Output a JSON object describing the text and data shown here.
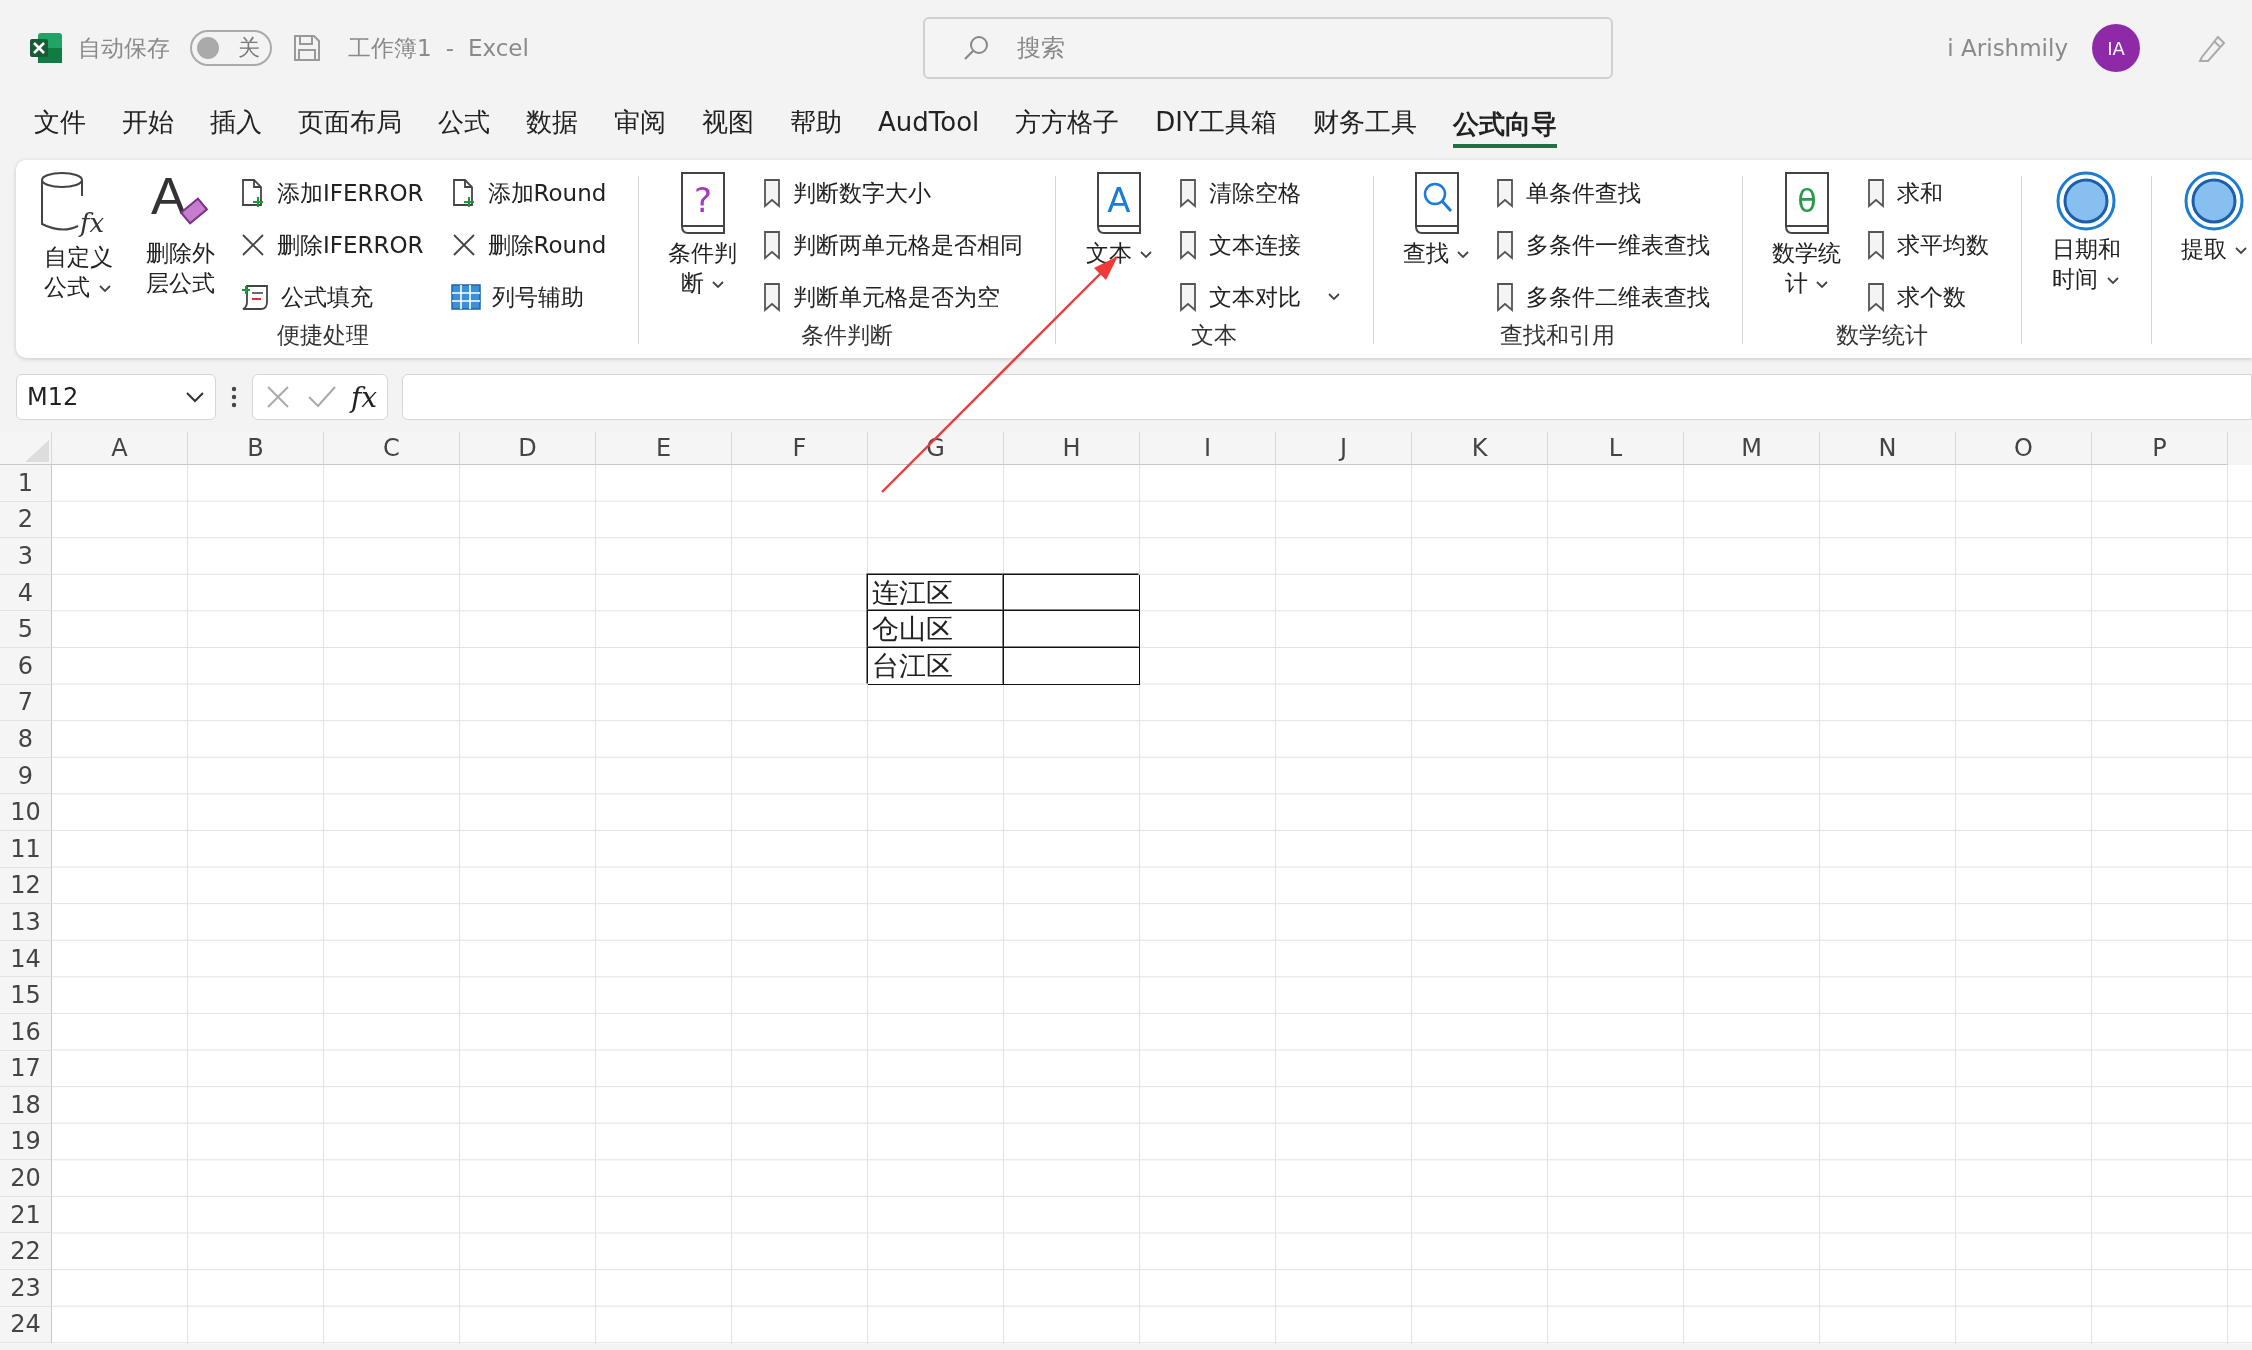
{
  "title_bar": {
    "autosave_label": "自动保存",
    "autosave": {
      "on": false,
      "label": "关"
    },
    "document": "工作簿1",
    "separator": "-",
    "app": "Excel",
    "search": {
      "placeholder": "搜索"
    },
    "user": "i Arishmily",
    "avatar": "IA"
  },
  "tabs": [
    {
      "label": "文件",
      "selected": false
    },
    {
      "label": "开始",
      "selected": false
    },
    {
      "label": "插入",
      "selected": false
    },
    {
      "label": "页面布局",
      "selected": false
    },
    {
      "label": "公式",
      "selected": false
    },
    {
      "label": "数据",
      "selected": false
    },
    {
      "label": "审阅",
      "selected": false
    },
    {
      "label": "视图",
      "selected": false
    },
    {
      "label": "帮助",
      "selected": false
    },
    {
      "label": "AudTool",
      "selected": false
    },
    {
      "label": "方方格子",
      "selected": false
    },
    {
      "label": "DIY工具箱",
      "selected": false
    },
    {
      "label": "财务工具",
      "selected": false
    },
    {
      "label": "公式向导",
      "selected": true
    }
  ],
  "ribbon": {
    "groups": [
      {
        "label": "便捷处理",
        "large": [
          {
            "lines": [
              "自定义",
              "公式"
            ],
            "dropdown": true,
            "icon_glyph": "fx"
          },
          {
            "lines": [
              "删除外",
              "层公式"
            ],
            "dropdown": false,
            "icon_glyph": "A"
          }
        ],
        "columns": [
          [
            {
              "label": "添加IFERROR",
              "dropdown": false
            },
            {
              "label": "删除IFERROR",
              "dropdown": false
            },
            {
              "label": "公式填充",
              "dropdown": false
            }
          ],
          [
            {
              "label": "添加Round",
              "dropdown": false
            },
            {
              "label": "删除Round",
              "dropdown": false
            },
            {
              "label": "列号辅助",
              "dropdown": false
            }
          ]
        ]
      },
      {
        "label": "条件判断",
        "large": [
          {
            "lines": [
              "条件判",
              "断"
            ],
            "dropdown": true,
            "icon_glyph": "?"
          }
        ],
        "columns": [
          [
            {
              "label": "判断数字大小",
              "dropdown": false
            },
            {
              "label": "判断两单元格是否相同",
              "dropdown": false
            },
            {
              "label": "判断单元格是否为空",
              "dropdown": false
            }
          ]
        ]
      },
      {
        "label": "文本",
        "large": [
          {
            "lines": [
              "文本"
            ],
            "dropdown": true,
            "icon_glyph": "A"
          }
        ],
        "columns": [
          [
            {
              "label": "清除空格",
              "dropdown": false
            },
            {
              "label": "文本连接",
              "dropdown": false
            },
            {
              "label": "文本对比",
              "dropdown": true
            }
          ]
        ]
      },
      {
        "label": "查找和引用",
        "large": [
          {
            "lines": [
              "查找"
            ],
            "dropdown": true
          }
        ],
        "columns": [
          [
            {
              "label": "单条件查找",
              "dropdown": false
            },
            {
              "label": "多条件一维表查找",
              "dropdown": false
            },
            {
              "label": "多条件二维表查找",
              "dropdown": false
            }
          ]
        ]
      },
      {
        "label": "数学统计",
        "large": [
          {
            "lines": [
              "数学统",
              "计"
            ],
            "dropdown": true,
            "icon_glyph": "θ"
          }
        ],
        "columns": [
          [
            {
              "label": "求和",
              "dropdown": false
            },
            {
              "label": "求平均数",
              "dropdown": false
            },
            {
              "label": "求个数",
              "dropdown": false
            }
          ]
        ]
      },
      {
        "large": [
          {
            "lines": [
              "日期和",
              "时间"
            ],
            "dropdown": true
          }
        ]
      },
      {
        "large": [
          {
            "lines": [
              "提取"
            ],
            "dropdown": true
          }
        ]
      }
    ]
  },
  "formula_bar": {
    "name_box": "M12",
    "function_label": "fx"
  },
  "sheet": {
    "columns": [
      "A",
      "B",
      "C",
      "D",
      "E",
      "F",
      "G",
      "H",
      "I",
      "J",
      "K",
      "L",
      "M",
      "N",
      "O",
      "P"
    ],
    "rows": [
      "1",
      "2",
      "3",
      "4",
      "5",
      "6",
      "7",
      "8",
      "9",
      "10",
      "11",
      "12",
      "13",
      "14",
      "15",
      "16",
      "17",
      "18",
      "19",
      "20",
      "21",
      "22",
      "23",
      "24"
    ],
    "table": {
      "rows": [
        "连江区",
        "仓山区",
        "台江区"
      ]
    }
  },
  "annotation": {
    "kind": "arrow"
  }
}
